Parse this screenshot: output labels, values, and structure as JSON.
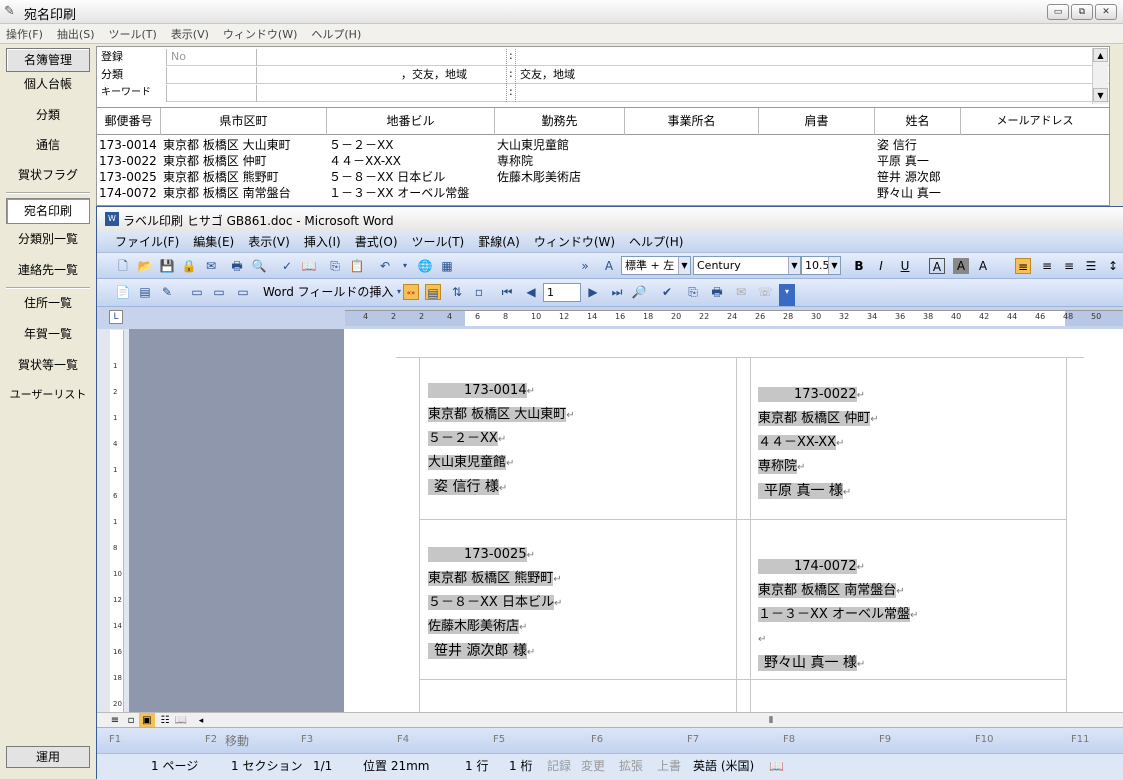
{
  "app": {
    "title": "宛名印刷",
    "menu": [
      "操作(F)",
      "抽出(S)",
      "ツール(T)",
      "表示(V)",
      "ウィンドウ(W)",
      "ヘルプ(H)"
    ],
    "window_buttons": [
      "▭",
      "⧉",
      "✕"
    ]
  },
  "sidebar": {
    "header": "名簿管理",
    "items": [
      "個人台帳",
      "分類",
      "通信",
      "賀状フラグ"
    ],
    "active": "宛名印刷",
    "items2": [
      "分類別一覧",
      "連絡先一覧"
    ],
    "items3": [
      "住所一覧",
      "年賀一覧",
      "賀状等一覧",
      "ユーザーリスト"
    ],
    "footer": "運用"
  },
  "form": {
    "rows": [
      {
        "label": "登録",
        "c1": "No",
        "c2": "",
        "c3": ""
      },
      {
        "label": "分類",
        "c1": "",
        "c2": "，交友，地域",
        "c3": "交友，地域"
      },
      {
        "label": "キーワード",
        "c1": "",
        "c2": "",
        "c3": ""
      }
    ],
    "sep": ":"
  },
  "grid": {
    "headers": [
      "郵便番号",
      "県市区町",
      "地番ビル",
      "勤務先",
      "事業所名",
      "肩書",
      "姓名",
      "メールアドレス"
    ],
    "rows": [
      [
        "173-0014",
        "東京都 板橋区 大山東町",
        "５－２－XX",
        "大山東児童館",
        "",
        "",
        "姿 信行",
        ""
      ],
      [
        "173-0022",
        "東京都 板橋区 仲町",
        "４４－XX-XX",
        "専称院",
        "",
        "",
        "平原 真一",
        ""
      ],
      [
        "173-0025",
        "東京都 板橋区 熊野町",
        "５－８－XX 日本ビル",
        "佐藤木彫美術店",
        "",
        "",
        "笹井 源次郎",
        ""
      ],
      [
        "174-0072",
        "東京都 板橋区 南常盤台",
        "１－３－XX オーベル常盤",
        "",
        "",
        "",
        "野々山 真一",
        ""
      ]
    ]
  },
  "word": {
    "title": "ラベル印刷 ヒサゴ GB861.doc - Microsoft Word",
    "menu": [
      "ファイル(F)",
      "編集(E)",
      "表示(V)",
      "挿入(I)",
      "書式(O)",
      "ツール(T)",
      "罫線(A)",
      "ウィンドウ(W)",
      "ヘルプ(H)"
    ],
    "style": "標準 + 左",
    "font": "Century",
    "size": "10.5",
    "merge_field": "Word フィールドの挿入",
    "record": "1",
    "ruler_ticks": [
      "4",
      "2",
      "2",
      "4",
      "6",
      "8",
      "10",
      "12",
      "14",
      "16",
      "18",
      "20",
      "22",
      "24",
      "26",
      "28",
      "30",
      "32",
      "34",
      "36",
      "38",
      "40",
      "42",
      "44",
      "46",
      "48",
      "50"
    ],
    "vruler_ticks": [
      "1",
      "2",
      "1",
      "4",
      "1",
      "6",
      "1",
      "8",
      "10",
      "12",
      "14",
      "16",
      "18",
      "20"
    ],
    "labels": [
      {
        "zip": "173-0014",
        "addr1": "東京都 板橋区 大山東町",
        "addr2": "５－２－XX",
        "org": "大山東児童館",
        "name": "姿 信行 様"
      },
      {
        "zip": "173-0022",
        "addr1": "東京都 板橋区 仲町",
        "addr2": "４４－XX-XX",
        "org": "専称院",
        "name": "平原 真一 様"
      },
      {
        "zip": "173-0025",
        "addr1": "東京都 板橋区 熊野町",
        "addr2": "５－８－XX 日本ビル",
        "org": "佐藤木彫美術店",
        "name": "笹井 源次郎 様"
      },
      {
        "zip": "174-0072",
        "addr1": "東京都 板橋区 南常盤台",
        "addr2": "１－３－XX オーベル常盤",
        "org": "",
        "name": "野々山 真一 様"
      }
    ],
    "fkeys": [
      "F1",
      "F2",
      "移動",
      "F3",
      "F4",
      "F5",
      "F6",
      "F7",
      "F8",
      "F9",
      "F10",
      "F11"
    ],
    "status": {
      "page": "1 ページ",
      "section": "1 セクション",
      "pages": "1/1",
      "pos": "位置 21mm",
      "line": "1 行",
      "col": "1 桁",
      "rec": "記録",
      "chg": "変更",
      "ext": "拡張",
      "ovr": "上書",
      "lang": "英語 (米国)"
    }
  },
  "colors": {
    "accent": "#2b579a",
    "highlight": "#c6c6c6"
  }
}
